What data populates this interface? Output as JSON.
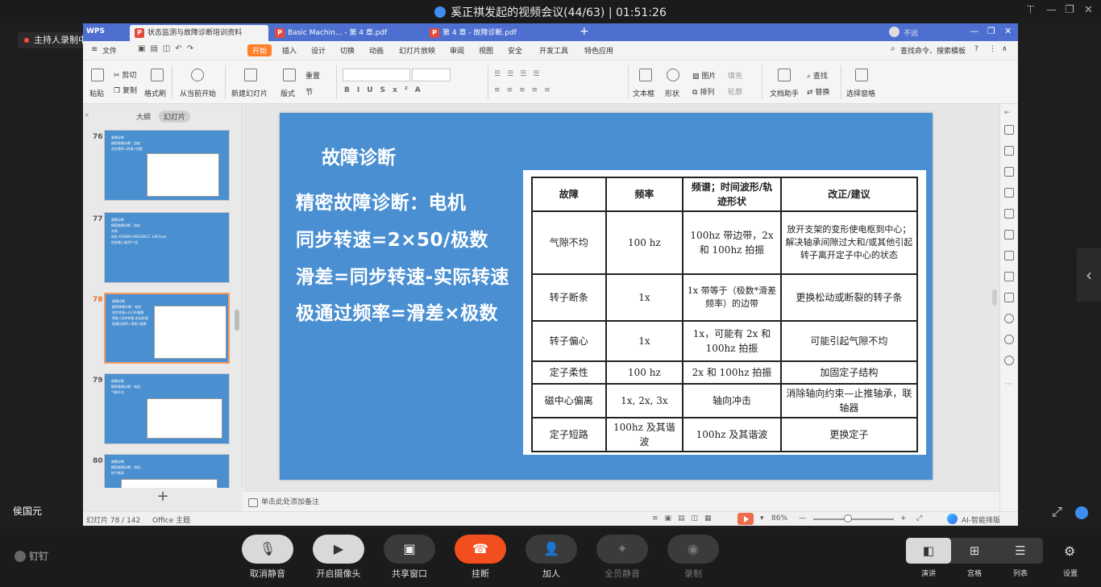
{
  "meeting": {
    "title": "奚正祺发起的视频会议(44/63) | 01:51:26",
    "recording": "主持人录制中",
    "speaker": "侯国元",
    "app_name": "钉钉"
  },
  "wps": {
    "brand": "WPS",
    "tabs": [
      {
        "label": "状态监测与故障诊断培训资料",
        "icon": "P"
      },
      {
        "label": "Basic Machin... - 第 4 章.pdf",
        "icon": "P"
      },
      {
        "label": "第 4 章 - 故障诊断.pdf",
        "icon": "P"
      }
    ],
    "user": "不远",
    "menus": [
      "文件",
      "开始",
      "插入",
      "设计",
      "切换",
      "动画",
      "幻灯片放映",
      "审阅",
      "视图",
      "安全",
      "开发工具",
      "特色应用"
    ],
    "search": "查找命令、搜索模板",
    "ribbon": {
      "paste": "粘贴",
      "cut": "剪切",
      "copy": "复制",
      "format_painter": "格式刷",
      "play_from_current": "从当前开始",
      "new_slide": "新建幻灯片",
      "layout": "版式",
      "reset": "重置",
      "section": "节",
      "textbox": "文本框",
      "shape": "形状",
      "picture": "图片",
      "fill": "填充",
      "arrange": "排列",
      "outline": "轮廓",
      "doc_assistant": "文档助手",
      "find": "查找",
      "replace": "替换",
      "select_pane": "选择窗格"
    },
    "panel": {
      "outline_tab": "大纲",
      "slides_tab": "幻灯片"
    },
    "slides": [
      {
        "num": "76",
        "lines": [
          "故障诊断",
          "精密故障诊断：齿轮",
          "齿合频率=转速×齿数"
        ]
      },
      {
        "num": "77",
        "lines": [
          "故障诊断",
          "精密故障诊断：齿轮",
          "实例",
          "电机 450KW2 M4S285CC 1487rpm",
          "齿轮输入轴39个齿"
        ]
      },
      {
        "num": "78",
        "lines": [
          "故障诊断",
          "精密故障诊断：电机",
          "同步转速=2×50/极数",
          "滑差=同步转速-实际转速",
          "极通过频率=滑差×极数"
        ]
      },
      {
        "num": "79",
        "lines": [
          "故障诊断",
          "精密故障诊断：电机",
          "气隙不均"
        ]
      },
      {
        "num": "80",
        "lines": [
          "故障诊断",
          "精密故障诊断：电机",
          "转子断条"
        ]
      }
    ],
    "notes_placeholder": "单击此处添加备注",
    "status": {
      "slide_count": "幻灯片 78 / 142",
      "theme": "Office 主题",
      "zoom": "86%",
      "ai": "AI-智能排版"
    }
  },
  "slide": {
    "heading": "故障诊断",
    "lines": [
      "精密故障诊断：电机",
      "同步转速=2×50/极数",
      "滑差=同步转速-实际转速",
      "极通过频率=滑差×极数"
    ],
    "table": {
      "headers": [
        "故障",
        "频率",
        "频谱；时间波形/轨迹形状",
        "改正/建议"
      ],
      "rows": [
        [
          "气隙不均",
          "100 hz",
          "100hz 带边带，2x 和 100hz 拍振",
          "放开支架的变形使电枢到中心；解决轴承间隙过大和/或其他引起转子离开定子中心的状态"
        ],
        [
          "转子断条",
          "1x",
          "1x 带等于（极数*滑差频率）的边带",
          "更换松动或断裂的转子条"
        ],
        [
          "转子偏心",
          "1x",
          "1x，可能有 2x 和 100hz 拍振",
          "可能引起气隙不均"
        ],
        [
          "定子柔性",
          "100 hz",
          "2x 和 100hz 拍振",
          "加固定子结构"
        ],
        [
          "磁中心偏离",
          "1x, 2x, 3x",
          "轴向冲击",
          "消除轴向约束—止推轴承，联轴器"
        ],
        [
          "定子短路",
          "100hz 及其谐波",
          "100hz 及其谐波",
          "更换定子"
        ]
      ]
    }
  },
  "controls": [
    {
      "label": "取消静音",
      "icon": "mic-icon"
    },
    {
      "label": "开启摄像头",
      "icon": "camera-off-icon"
    },
    {
      "label": "共享窗口",
      "icon": "share-icon"
    },
    {
      "label": "挂断",
      "icon": "hangup-icon"
    },
    {
      "label": "加人",
      "icon": "add-person-icon"
    },
    {
      "label": "全员静音",
      "icon": "mute-all-icon"
    },
    {
      "label": "录制",
      "icon": "record-icon"
    }
  ],
  "layout_modes": [
    "演讲",
    "宫格",
    "列表"
  ],
  "settings": "设置"
}
